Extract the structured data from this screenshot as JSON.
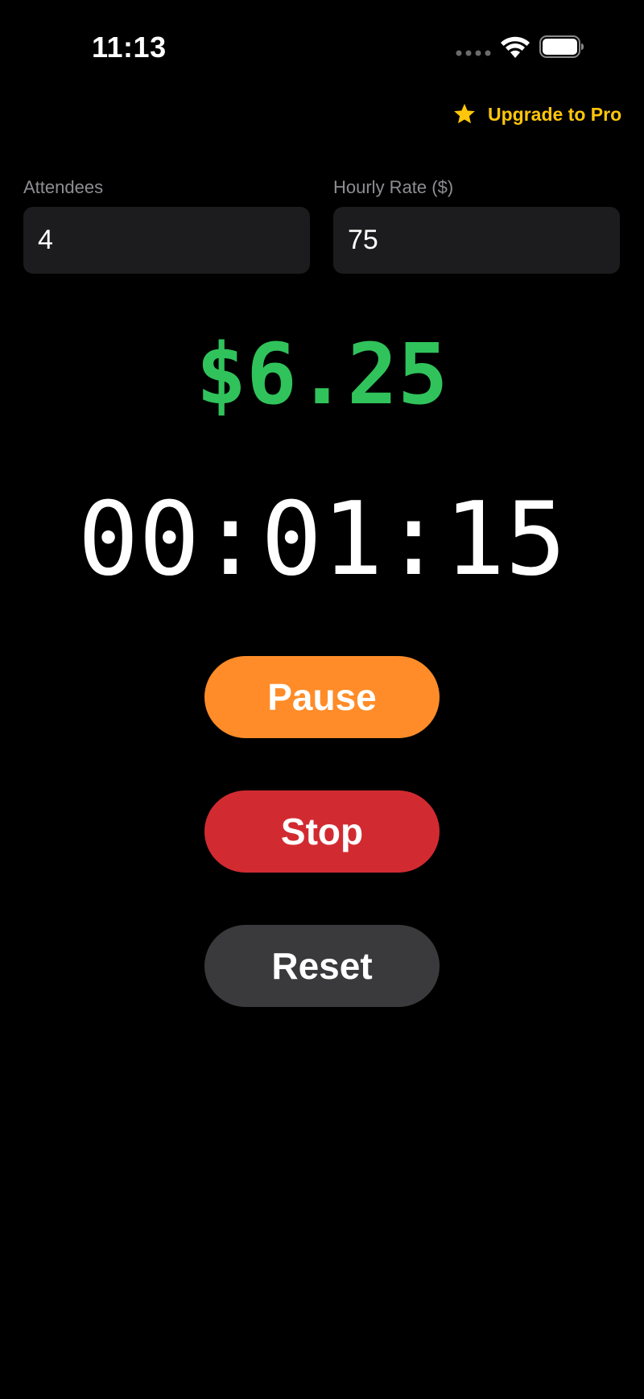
{
  "status_bar": {
    "time": "11:13"
  },
  "upgrade": {
    "label": "Upgrade to Pro",
    "icon": "star-icon",
    "color": "#FFC60B"
  },
  "fields": {
    "attendees": {
      "label": "Attendees",
      "value": "4"
    },
    "hourly_rate": {
      "label": "Hourly Rate ($)",
      "value": "75"
    }
  },
  "cost": {
    "value": "$6.25",
    "color": "#30C35B"
  },
  "timer": {
    "value": "00:01:15"
  },
  "buttons": {
    "pause": {
      "label": "Pause",
      "color": "#FF8C28"
    },
    "stop": {
      "label": "Stop",
      "color": "#D12B31"
    },
    "reset": {
      "label": "Reset",
      "color": "#3A3A3C"
    }
  }
}
